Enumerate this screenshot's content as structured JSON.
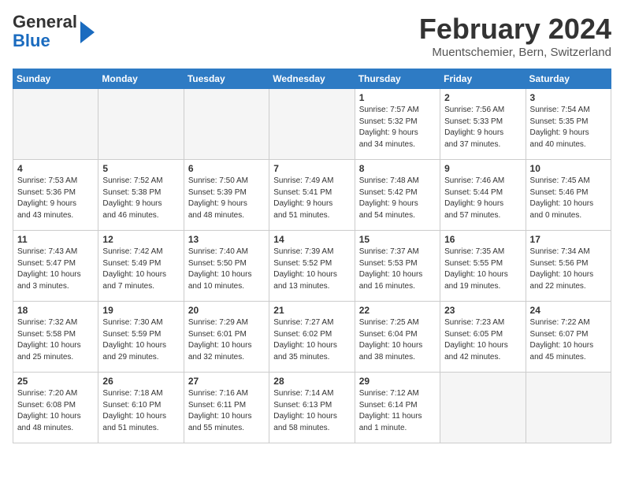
{
  "header": {
    "logo_line1": "General",
    "logo_line2": "Blue",
    "month_year": "February 2024",
    "location": "Muentschemier, Bern, Switzerland"
  },
  "weekdays": [
    "Sunday",
    "Monday",
    "Tuesday",
    "Wednesday",
    "Thursday",
    "Friday",
    "Saturday"
  ],
  "weeks": [
    [
      {
        "day": "",
        "info": ""
      },
      {
        "day": "",
        "info": ""
      },
      {
        "day": "",
        "info": ""
      },
      {
        "day": "",
        "info": ""
      },
      {
        "day": "1",
        "info": "Sunrise: 7:57 AM\nSunset: 5:32 PM\nDaylight: 9 hours\nand 34 minutes."
      },
      {
        "day": "2",
        "info": "Sunrise: 7:56 AM\nSunset: 5:33 PM\nDaylight: 9 hours\nand 37 minutes."
      },
      {
        "day": "3",
        "info": "Sunrise: 7:54 AM\nSunset: 5:35 PM\nDaylight: 9 hours\nand 40 minutes."
      }
    ],
    [
      {
        "day": "4",
        "info": "Sunrise: 7:53 AM\nSunset: 5:36 PM\nDaylight: 9 hours\nand 43 minutes."
      },
      {
        "day": "5",
        "info": "Sunrise: 7:52 AM\nSunset: 5:38 PM\nDaylight: 9 hours\nand 46 minutes."
      },
      {
        "day": "6",
        "info": "Sunrise: 7:50 AM\nSunset: 5:39 PM\nDaylight: 9 hours\nand 48 minutes."
      },
      {
        "day": "7",
        "info": "Sunrise: 7:49 AM\nSunset: 5:41 PM\nDaylight: 9 hours\nand 51 minutes."
      },
      {
        "day": "8",
        "info": "Sunrise: 7:48 AM\nSunset: 5:42 PM\nDaylight: 9 hours\nand 54 minutes."
      },
      {
        "day": "9",
        "info": "Sunrise: 7:46 AM\nSunset: 5:44 PM\nDaylight: 9 hours\nand 57 minutes."
      },
      {
        "day": "10",
        "info": "Sunrise: 7:45 AM\nSunset: 5:46 PM\nDaylight: 10 hours\nand 0 minutes."
      }
    ],
    [
      {
        "day": "11",
        "info": "Sunrise: 7:43 AM\nSunset: 5:47 PM\nDaylight: 10 hours\nand 3 minutes."
      },
      {
        "day": "12",
        "info": "Sunrise: 7:42 AM\nSunset: 5:49 PM\nDaylight: 10 hours\nand 7 minutes."
      },
      {
        "day": "13",
        "info": "Sunrise: 7:40 AM\nSunset: 5:50 PM\nDaylight: 10 hours\nand 10 minutes."
      },
      {
        "day": "14",
        "info": "Sunrise: 7:39 AM\nSunset: 5:52 PM\nDaylight: 10 hours\nand 13 minutes."
      },
      {
        "day": "15",
        "info": "Sunrise: 7:37 AM\nSunset: 5:53 PM\nDaylight: 10 hours\nand 16 minutes."
      },
      {
        "day": "16",
        "info": "Sunrise: 7:35 AM\nSunset: 5:55 PM\nDaylight: 10 hours\nand 19 minutes."
      },
      {
        "day": "17",
        "info": "Sunrise: 7:34 AM\nSunset: 5:56 PM\nDaylight: 10 hours\nand 22 minutes."
      }
    ],
    [
      {
        "day": "18",
        "info": "Sunrise: 7:32 AM\nSunset: 5:58 PM\nDaylight: 10 hours\nand 25 minutes."
      },
      {
        "day": "19",
        "info": "Sunrise: 7:30 AM\nSunset: 5:59 PM\nDaylight: 10 hours\nand 29 minutes."
      },
      {
        "day": "20",
        "info": "Sunrise: 7:29 AM\nSunset: 6:01 PM\nDaylight: 10 hours\nand 32 minutes."
      },
      {
        "day": "21",
        "info": "Sunrise: 7:27 AM\nSunset: 6:02 PM\nDaylight: 10 hours\nand 35 minutes."
      },
      {
        "day": "22",
        "info": "Sunrise: 7:25 AM\nSunset: 6:04 PM\nDaylight: 10 hours\nand 38 minutes."
      },
      {
        "day": "23",
        "info": "Sunrise: 7:23 AM\nSunset: 6:05 PM\nDaylight: 10 hours\nand 42 minutes."
      },
      {
        "day": "24",
        "info": "Sunrise: 7:22 AM\nSunset: 6:07 PM\nDaylight: 10 hours\nand 45 minutes."
      }
    ],
    [
      {
        "day": "25",
        "info": "Sunrise: 7:20 AM\nSunset: 6:08 PM\nDaylight: 10 hours\nand 48 minutes."
      },
      {
        "day": "26",
        "info": "Sunrise: 7:18 AM\nSunset: 6:10 PM\nDaylight: 10 hours\nand 51 minutes."
      },
      {
        "day": "27",
        "info": "Sunrise: 7:16 AM\nSunset: 6:11 PM\nDaylight: 10 hours\nand 55 minutes."
      },
      {
        "day": "28",
        "info": "Sunrise: 7:14 AM\nSunset: 6:13 PM\nDaylight: 10 hours\nand 58 minutes."
      },
      {
        "day": "29",
        "info": "Sunrise: 7:12 AM\nSunset: 6:14 PM\nDaylight: 11 hours\nand 1 minute."
      },
      {
        "day": "",
        "info": ""
      },
      {
        "day": "",
        "info": ""
      }
    ]
  ]
}
